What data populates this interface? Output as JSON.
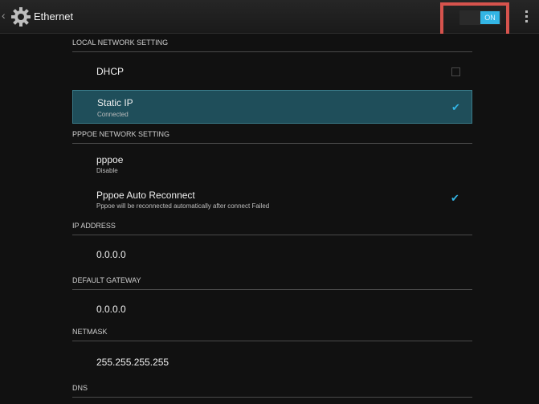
{
  "actionbar": {
    "title": "Ethernet",
    "icon": "gear-icon",
    "toggle_label": "ON",
    "accent_color": "#33b5e5",
    "highlight_color": "#d6534d"
  },
  "sections": {
    "local": "LOCAL NETWORK SETTING",
    "pppoe": "PPPOE NETWORK SETTING",
    "ip": "IP ADDRESS",
    "gateway": "DEFAULT GATEWAY",
    "netmask": "NETMASK",
    "dns": "DNS"
  },
  "dhcp": {
    "label": "DHCP",
    "checked": false
  },
  "static_ip": {
    "label": "Static IP",
    "status": "Connected",
    "checked": true
  },
  "pppoe": {
    "label": "pppoe",
    "status": "Disable"
  },
  "auto_reconnect": {
    "label": "Pppoe Auto Reconnect",
    "description": "Pppoe will be reconnected automatically after connect Failed",
    "checked": true
  },
  "ip_address": "0.0.0.0",
  "default_gateway": "0.0.0.0",
  "netmask": "255.255.255.255"
}
